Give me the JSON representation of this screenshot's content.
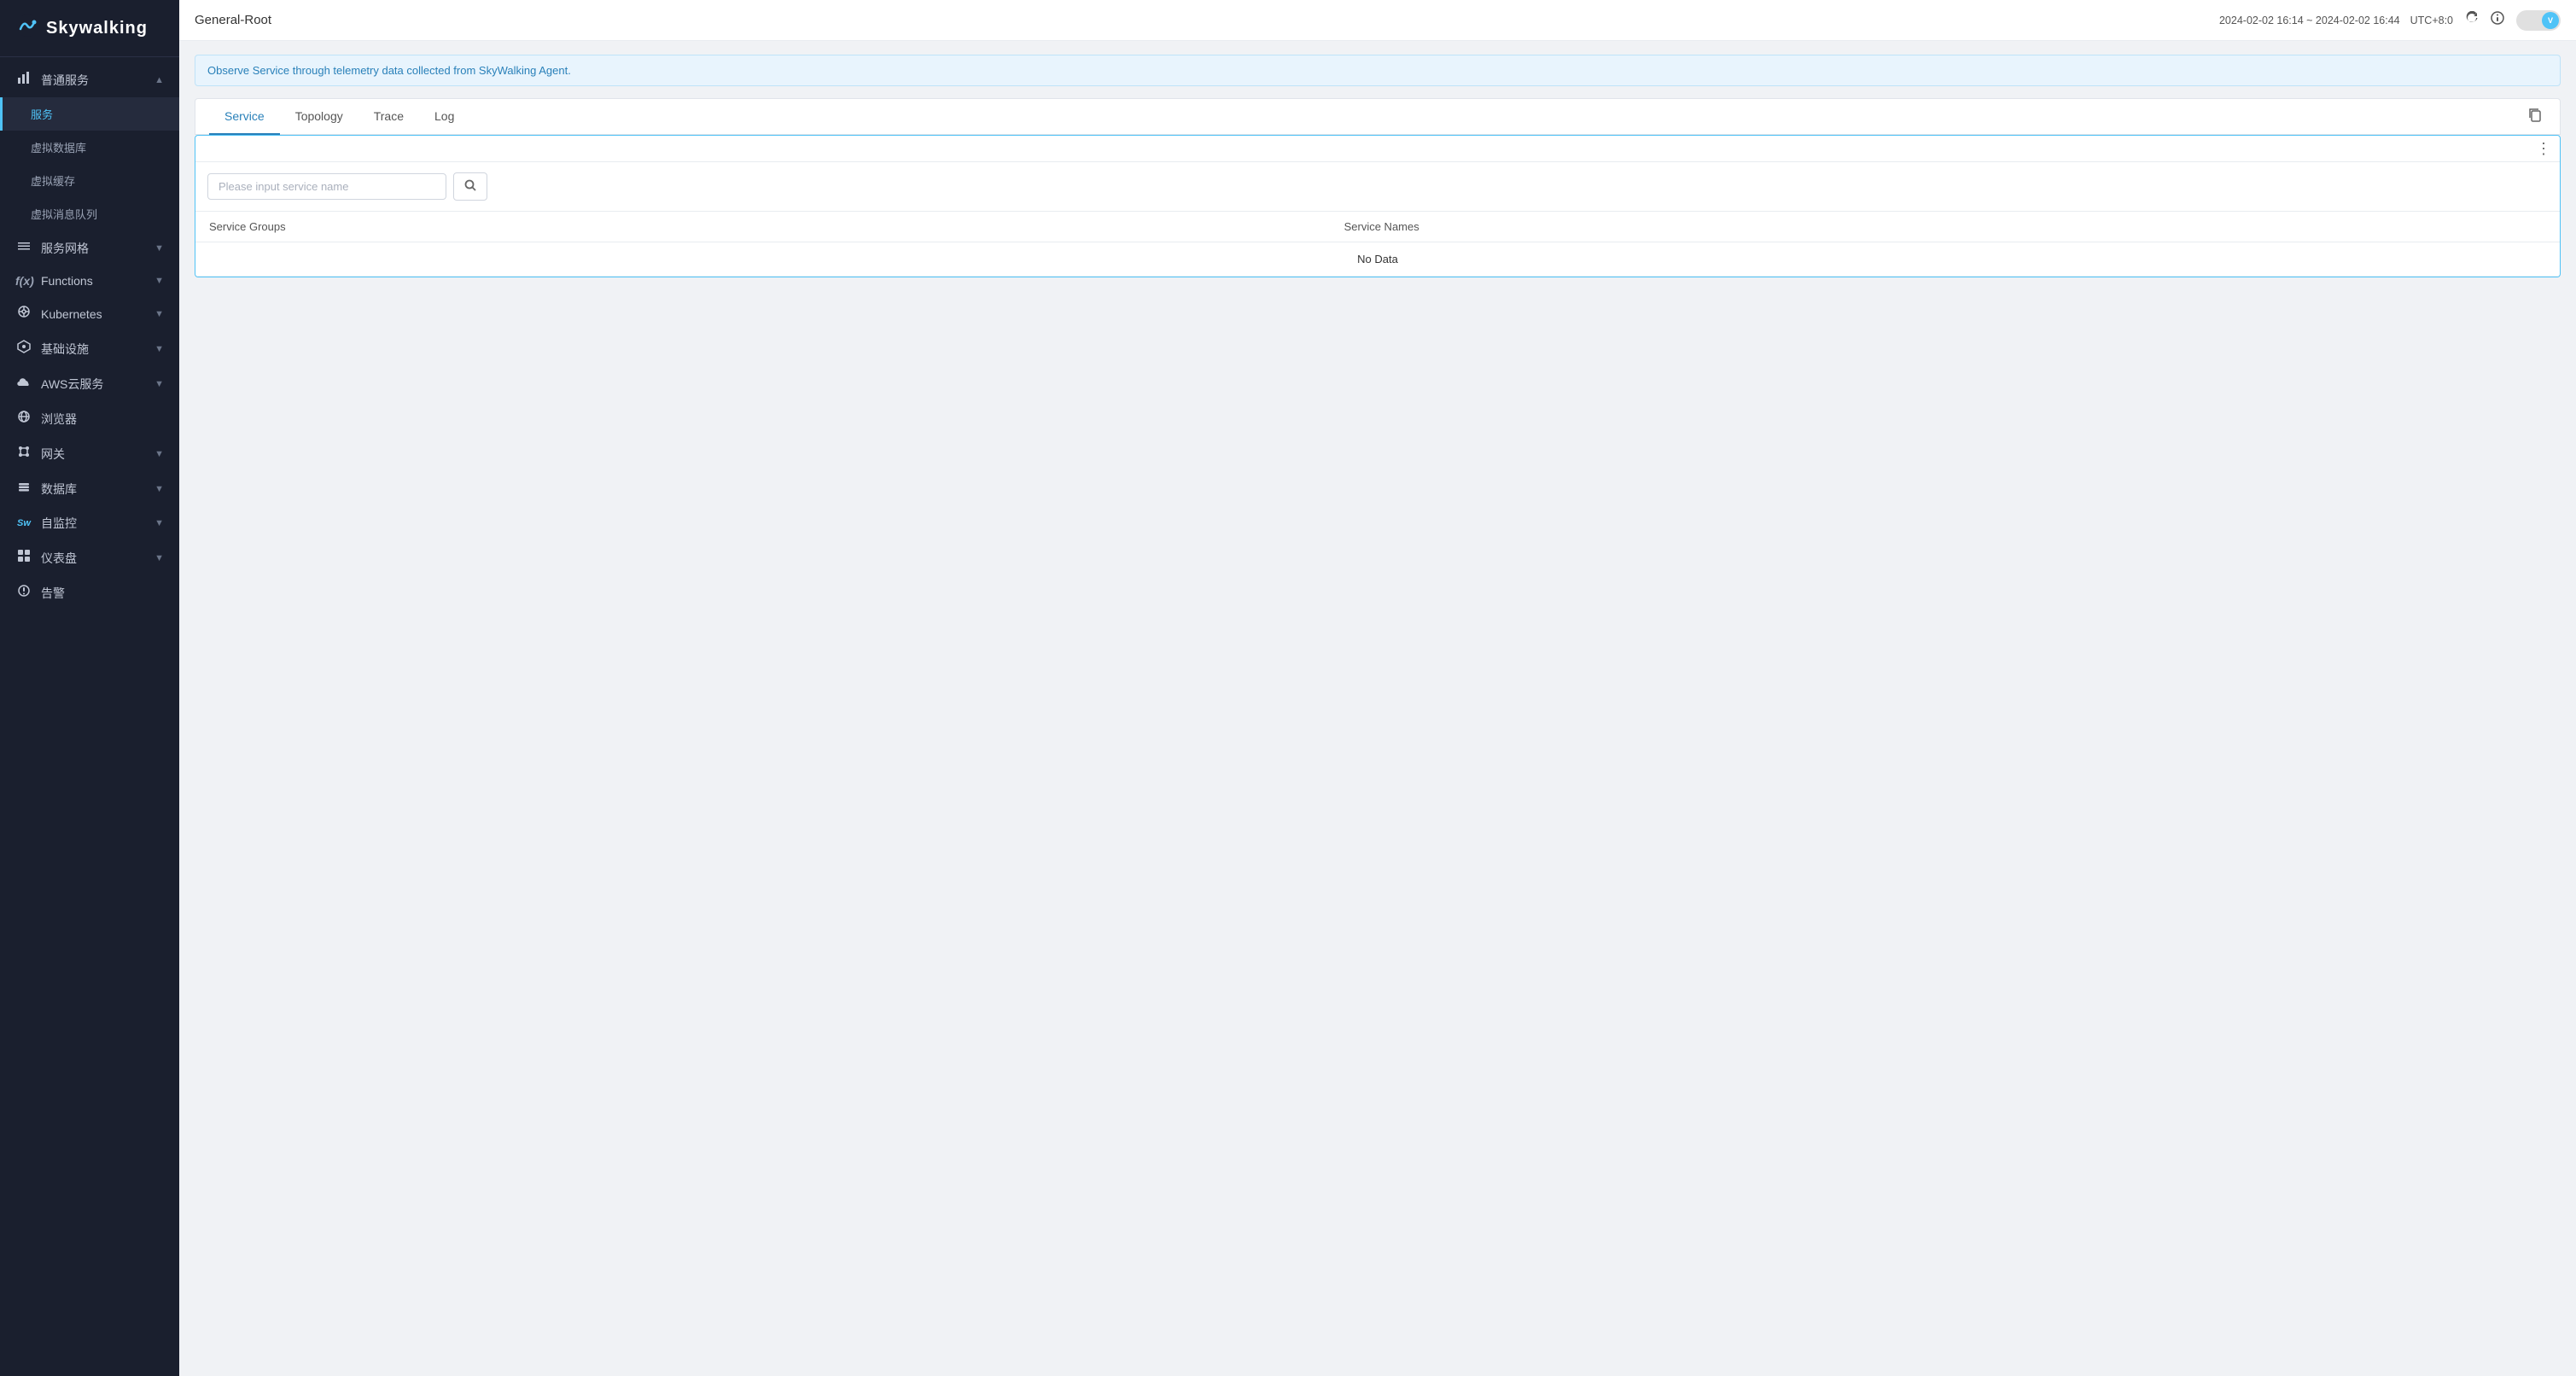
{
  "sidebar": {
    "logo_text": "Skywalking",
    "items": [
      {
        "id": "general-services",
        "label": "普通服务",
        "icon": "📊",
        "level": "parent",
        "expanded": true
      },
      {
        "id": "services",
        "label": "服务",
        "icon": "",
        "level": "child",
        "active": true
      },
      {
        "id": "virtual-db",
        "label": "虚拟数据库",
        "icon": "",
        "level": "child"
      },
      {
        "id": "virtual-cache",
        "label": "虚拟缓存",
        "icon": "",
        "level": "child"
      },
      {
        "id": "virtual-mq",
        "label": "虚拟消息队列",
        "icon": "",
        "level": "child"
      },
      {
        "id": "service-mesh",
        "label": "服务网格",
        "icon": "☰",
        "level": "parent"
      },
      {
        "id": "functions",
        "label": "Functions",
        "icon": "ƒ",
        "level": "parent"
      },
      {
        "id": "kubernetes",
        "label": "Kubernetes",
        "icon": "⊙",
        "level": "parent"
      },
      {
        "id": "infrastructure",
        "label": "基础设施",
        "icon": "✦",
        "level": "parent"
      },
      {
        "id": "aws-cloud",
        "label": "AWS云服务",
        "icon": "☁",
        "level": "parent"
      },
      {
        "id": "browser",
        "label": "浏览器",
        "icon": "🌐",
        "level": "parent"
      },
      {
        "id": "gateway",
        "label": "网关",
        "icon": "⚙",
        "level": "parent"
      },
      {
        "id": "database",
        "label": "数据库",
        "icon": "☰",
        "level": "parent"
      },
      {
        "id": "self-monitor",
        "label": "自监控",
        "icon": "Sw",
        "level": "parent"
      },
      {
        "id": "dashboard",
        "label": "仪表盘",
        "icon": "⊞",
        "level": "parent"
      },
      {
        "id": "alert",
        "label": "告警",
        "icon": "⚠",
        "level": "parent"
      }
    ]
  },
  "topbar": {
    "title": "General-Root",
    "time_range": "2024-02-02  16:14 ~ 2024-02-02  16:44",
    "timezone": "UTC+8:0",
    "toggle_label": "V"
  },
  "info_bar": {
    "text": "Observe Service through telemetry data collected from SkyWalking Agent."
  },
  "tabs": [
    {
      "id": "service",
      "label": "Service",
      "active": true
    },
    {
      "id": "topology",
      "label": "Topology"
    },
    {
      "id": "trace",
      "label": "Trace"
    },
    {
      "id": "log",
      "label": "Log"
    }
  ],
  "table": {
    "columns": [
      {
        "id": "service-groups",
        "label": "Service Groups"
      },
      {
        "id": "service-names",
        "label": "Service Names"
      }
    ],
    "no_data_text": "No Data",
    "search_placeholder": "Please input service name",
    "search_button_icon": "🔍"
  },
  "colors": {
    "accent": "#4fc3f7",
    "sidebar_bg": "#1a1f2e",
    "active_text": "#2980b9"
  }
}
